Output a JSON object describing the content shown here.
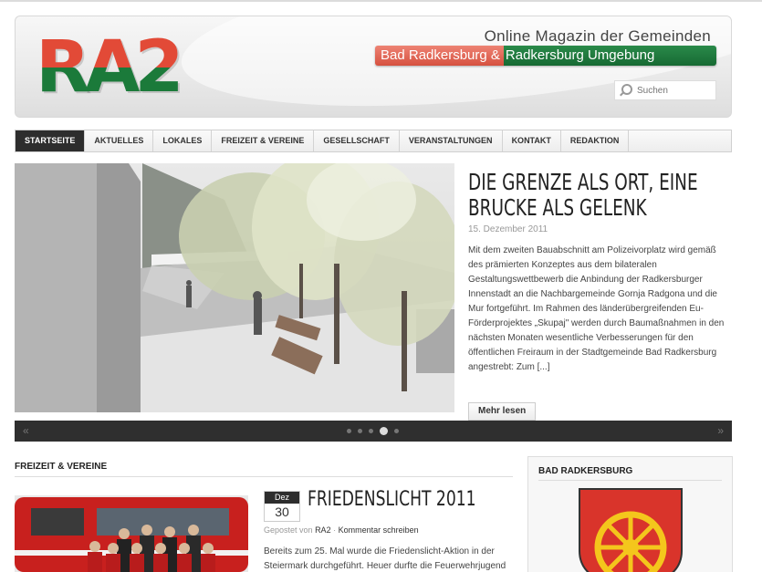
{
  "header": {
    "logo_text": "RA2",
    "tagline": "Online Magazin der Gemeinden",
    "banner_left": "Bad Radkersburg &",
    "banner_right": "Radkersburg Umgebung",
    "search_placeholder": "Suchen"
  },
  "nav": {
    "items": [
      {
        "label": "STARTSEITE",
        "active": true
      },
      {
        "label": "AKTUELLES"
      },
      {
        "label": "LOKALES"
      },
      {
        "label": "FREIZEIT & VEREINE"
      },
      {
        "label": "GESELLSCHAFT"
      },
      {
        "label": "VERANSTALTUNGEN"
      },
      {
        "label": "KONTAKT"
      },
      {
        "label": "REDAKTION"
      }
    ]
  },
  "slider": {
    "title": "DIE GRENZE ALS ORT, EINE BRUCKE ALS GELENK",
    "date": "15. Dezember 2011",
    "text": "Mit dem zweiten Bauabschnitt am Polizeivorplatz wird gemäß des prämierten Konzeptes aus dem bilateralen Gestaltungswettbewerb die Anbindung der Radkersburger Innenstadt an die Nachbargemeinde Gornja Radgona und die Mur fortgeführt. Im Rahmen des länderübergreifenden Eu-Förderprojektes „Skupaj\" werden durch Baumaßnahmen in den nächsten Monaten wesentliche Verbesserungen für den öffentlichen Freiraum in der Stadtgemeinde Bad Radkersburg angestrebt: Zum [...]",
    "more_label": "Mehr lesen",
    "prev": "«",
    "next": "»",
    "active_dot": 4,
    "dot_count": 5
  },
  "section": {
    "title": "FREIZEIT & VEREINE",
    "post": {
      "month": "Dez",
      "day": "30",
      "title": "FRIEDENSLICHT 2011",
      "meta_prefix": "Gepostet von",
      "author": "RA2",
      "comment_link": "Kommentar schreiben",
      "text": "Bereits zum 25. Mal wurde die Friedenslicht-Aktion in der Steiermark durchgeführt. Heuer durfte die Feuerwehrjugend"
    }
  },
  "widget": {
    "title": "BAD RADKERSBURG"
  },
  "colors": {
    "brand_red": "#e24a37",
    "brand_green": "#1b7a3a",
    "nav_active": "#2d2d2d"
  }
}
